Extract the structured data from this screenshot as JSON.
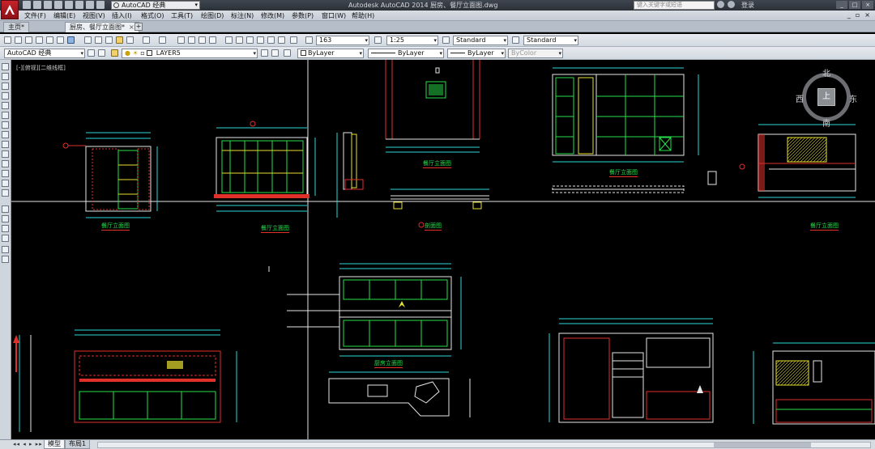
{
  "titlebar": {
    "workspace": "AutoCAD 经典",
    "title": "Autodesk AutoCAD 2014    厨房、餐厅立面图.dwg",
    "search_placeholder": "键入关键字或短语",
    "login": "登录"
  },
  "menu": {
    "items": [
      "文件(F)",
      "编辑(E)",
      "视图(V)",
      "插入(I)",
      "格式(O)",
      "工具(T)",
      "绘图(D)",
      "标注(N)",
      "修改(M)",
      "参数(P)",
      "窗口(W)",
      "帮助(H)"
    ]
  },
  "tabs": {
    "items": [
      "主页*",
      "厨房、餐厅立面图*"
    ]
  },
  "toolbar": {
    "text_style_value": "163",
    "dim_scale_value": "1:25",
    "table_style_value": "Standard",
    "multileader_style_value": "Standard",
    "workspace_value": "AutoCAD 经典",
    "layer_value": "LAYER5",
    "color_value": "ByLayer",
    "linetype_value": "ByLayer",
    "lineweight_value": "ByLayer",
    "plotstyle_value": "ByColor"
  },
  "viewport": {
    "label": "[-][俯视][二维线框]"
  },
  "viewcube": {
    "north": "北",
    "south": "南",
    "east": "东",
    "west": "西",
    "top": "上"
  },
  "drawing": {
    "titles": [
      "餐厅立面图",
      "餐厅立面图",
      "餐厅立面图",
      "剖面图",
      "餐厅立面图",
      "餐厅立面图",
      "厨房立面图"
    ]
  },
  "layout_tabs": {
    "items": [
      "模型",
      "布局1"
    ]
  },
  "colors": {
    "canvas_bg": "#000000",
    "cad_green": "#27e04a",
    "cad_yellow": "#e8e030",
    "cad_red": "#e0302a",
    "cad_white": "#e6e6e6",
    "cad_cyan": "#2cd8d8"
  }
}
